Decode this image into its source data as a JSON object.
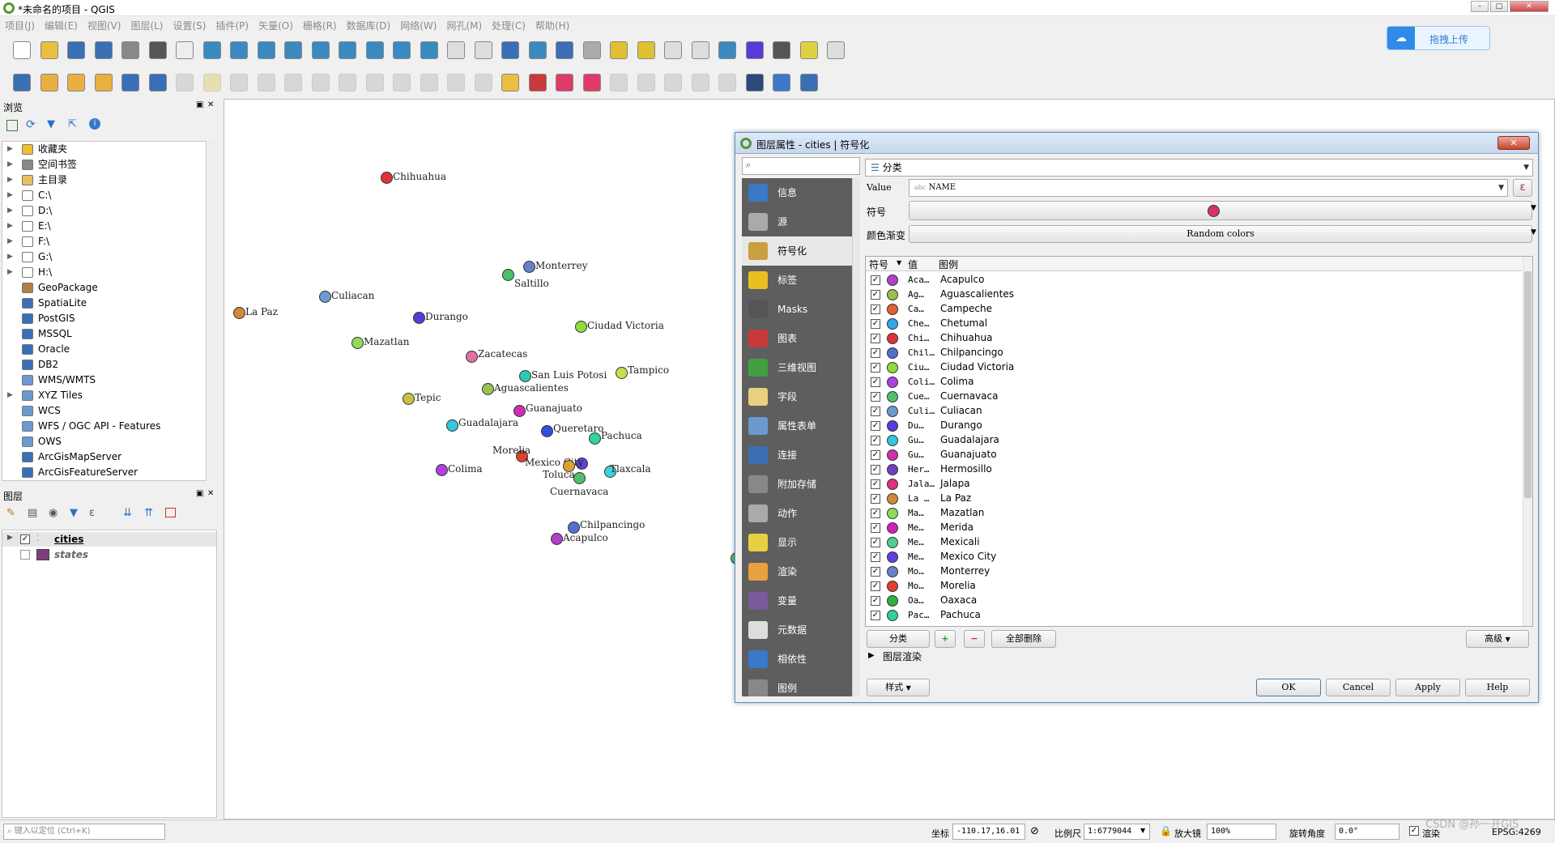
{
  "window": {
    "title": "*未命名的项目 - QGIS"
  },
  "menu": [
    "项目(J)",
    "编辑(E)",
    "视图(V)",
    "图层(L)",
    "设置(S)",
    "插件(P)",
    "矢量(O)",
    "栅格(R)",
    "数据库(D)",
    "网络(W)",
    "网孔(M)",
    "处理(C)",
    "帮助(H)"
  ],
  "cloud_button": {
    "label": "拖拽上传"
  },
  "browser": {
    "title": "浏览",
    "items": [
      {
        "label": "收藏夹",
        "icon": "star-icon"
      },
      {
        "label": "空间书签",
        "icon": "bookmark-icon"
      },
      {
        "label": "主目录",
        "icon": "home-folder-icon"
      },
      {
        "label": "C:\\",
        "icon": "folder-icon"
      },
      {
        "label": "D:\\",
        "icon": "folder-icon"
      },
      {
        "label": "E:\\",
        "icon": "folder-icon"
      },
      {
        "label": "F:\\",
        "icon": "folder-icon"
      },
      {
        "label": "G:\\",
        "icon": "folder-icon"
      },
      {
        "label": "H:\\",
        "icon": "folder-icon"
      },
      {
        "label": "GeoPackage",
        "icon": "geopackage-icon"
      },
      {
        "label": "SpatiaLite",
        "icon": "spatialite-icon"
      },
      {
        "label": "PostGIS",
        "icon": "postgis-icon"
      },
      {
        "label": "MSSQL",
        "icon": "mssql-icon"
      },
      {
        "label": "Oracle",
        "icon": "oracle-icon"
      },
      {
        "label": "DB2",
        "icon": "db2-icon"
      },
      {
        "label": "WMS/WMTS",
        "icon": "globe-icon"
      },
      {
        "label": "XYZ Tiles",
        "icon": "xyz-tiles-icon"
      },
      {
        "label": "WCS",
        "icon": "globe-icon"
      },
      {
        "label": "WFS / OGC API - Features",
        "icon": "globe-icon"
      },
      {
        "label": "OWS",
        "icon": "globe-icon"
      },
      {
        "label": "ArcGisMapServer",
        "icon": "arcgis-icon"
      },
      {
        "label": "ArcGisFeatureServer",
        "icon": "arcgis-icon"
      }
    ]
  },
  "layers_panel": {
    "title": "图层",
    "layers": [
      {
        "name": "cities",
        "checked": true
      },
      {
        "name": "states",
        "checked": false
      }
    ]
  },
  "map": {
    "cities": [
      {
        "name": "Chihuahua",
        "color": "#e0303a"
      },
      {
        "name": "Monterrey",
        "color": "#6a7fc8"
      },
      {
        "name": "Saltillo",
        "color": "#4cbf6a"
      },
      {
        "name": "Culiacan",
        "color": "#6c9bd4"
      },
      {
        "name": "La Paz",
        "color": "#d08a3a"
      },
      {
        "name": "Durango",
        "color": "#5a3ad8"
      },
      {
        "name": "Ciudad Victoria",
        "color": "#90dc40"
      },
      {
        "name": "Mazatlan",
        "color": "#8fdc5a"
      },
      {
        "name": "Zacatecas",
        "color": "#e070a0"
      },
      {
        "name": "San Luis Potosi",
        "color": "#30c8b0"
      },
      {
        "name": "Tampico",
        "color": "#c8e050"
      },
      {
        "name": "Aguascalientes",
        "color": "#9ac050"
      },
      {
        "name": "Tepic",
        "color": "#c8c040"
      },
      {
        "name": "Guanajuato",
        "color": "#d030b0"
      },
      {
        "name": "Guadalajara",
        "color": "#30c8e0"
      },
      {
        "name": "Queretaro",
        "color": "#3050e0"
      },
      {
        "name": "Pachuca",
        "color": "#30d0a0"
      },
      {
        "name": "Morelia",
        "color": "#e04030"
      },
      {
        "name": "Mexico City",
        "color": "#6040d8"
      },
      {
        "name": "Tlaxcala",
        "color": "#40d0e0"
      },
      {
        "name": "Toluca",
        "color": "#e0a030"
      },
      {
        "name": "Cuernavaca",
        "color": "#50c070"
      },
      {
        "name": "Colima",
        "color": "#b040e0"
      },
      {
        "name": "Chilpancingo",
        "color": "#5070d0"
      },
      {
        "name": "Acapulco",
        "color": "#b040c8"
      }
    ]
  },
  "dialog": {
    "title": "图层属性 - cities | 符号化",
    "close_label": "✕",
    "renderer": "分类",
    "value_label": "Value",
    "value_field": "NAME",
    "value_field_prefix": "abc",
    "symbol_label": "符号",
    "ramp_label": "颜色渐变",
    "ramp_value": "Random colors",
    "symbol_color": "#d6336c",
    "nav": [
      {
        "label": "信息",
        "icon": "info-icon"
      },
      {
        "label": "源",
        "icon": "source-icon"
      },
      {
        "label": "符号化",
        "icon": "symbology-icon",
        "selected": true
      },
      {
        "label": "标签",
        "icon": "labels-icon"
      },
      {
        "label": "Masks",
        "icon": "masks-icon"
      },
      {
        "label": "图表",
        "icon": "diagrams-icon"
      },
      {
        "label": "三维视图",
        "icon": "3d-view-icon"
      },
      {
        "label": "字段",
        "icon": "fields-icon"
      },
      {
        "label": "属性表单",
        "icon": "attributes-form-icon"
      },
      {
        "label": "连接",
        "icon": "joins-icon"
      },
      {
        "label": "附加存储",
        "icon": "auxiliary-storage-icon"
      },
      {
        "label": "动作",
        "icon": "actions-icon"
      },
      {
        "label": "显示",
        "icon": "display-icon"
      },
      {
        "label": "渲染",
        "icon": "rendering-icon"
      },
      {
        "label": "变量",
        "icon": "variables-icon"
      },
      {
        "label": "元数据",
        "icon": "metadata-icon"
      },
      {
        "label": "相依性",
        "icon": "dependencies-icon"
      },
      {
        "label": "图例",
        "icon": "legend-icon"
      }
    ],
    "table_headers": {
      "symbol": "符号",
      "value": "值",
      "legend": "图例"
    },
    "categories": [
      {
        "value": "Aca…",
        "legend": "Acapulco",
        "color": "#b040c8"
      },
      {
        "value": "Ag…",
        "legend": "Aguascalientes",
        "color": "#9ac050"
      },
      {
        "value": "Ca…",
        "legend": "Campeche",
        "color": "#e06030"
      },
      {
        "value": "Che…",
        "legend": "Chetumal",
        "color": "#30a8e8"
      },
      {
        "value": "Chi…",
        "legend": "Chihuahua",
        "color": "#e0303a"
      },
      {
        "value": "Chil…",
        "legend": "Chilpancingo",
        "color": "#5070d0"
      },
      {
        "value": "Ciu…",
        "legend": "Ciudad Victoria",
        "color": "#90dc40"
      },
      {
        "value": "Coli…",
        "legend": "Colima",
        "color": "#b040e0"
      },
      {
        "value": "Cue…",
        "legend": "Cuernavaca",
        "color": "#50c070"
      },
      {
        "value": "Culi…",
        "legend": "Culiacan",
        "color": "#6c9bd4"
      },
      {
        "value": "Du…",
        "legend": "Durango",
        "color": "#5a3ad8"
      },
      {
        "value": "Gu…",
        "legend": "Guadalajara",
        "color": "#30c8e0"
      },
      {
        "value": "Gu…",
        "legend": "Guanajuato",
        "color": "#d030b0"
      },
      {
        "value": "Her…",
        "legend": "Hermosillo",
        "color": "#7040c0"
      },
      {
        "value": "Jala…",
        "legend": "Jalapa",
        "color": "#e03080"
      },
      {
        "value": "La …",
        "legend": "La Paz",
        "color": "#d08a3a"
      },
      {
        "value": "Ma…",
        "legend": "Mazatlan",
        "color": "#8fdc5a"
      },
      {
        "value": "Me…",
        "legend": "Merida",
        "color": "#d020c0"
      },
      {
        "value": "Me…",
        "legend": "Mexicali",
        "color": "#50d090"
      },
      {
        "value": "Me…",
        "legend": "Mexico City",
        "color": "#6040d8"
      },
      {
        "value": "Mo…",
        "legend": "Monterrey",
        "color": "#6a7fc8"
      },
      {
        "value": "Mo…",
        "legend": "Morelia",
        "color": "#e04030"
      },
      {
        "value": "Oa…",
        "legend": "Oaxaca",
        "color": "#30b040"
      },
      {
        "value": "Pac…",
        "legend": "Pachuca",
        "color": "#30d0a0"
      }
    ],
    "buttons": {
      "classify": "分类",
      "add": "+",
      "remove": "−",
      "delete_all": "全部删除",
      "advanced": "高级",
      "layer_rendering": "图层渲染",
      "style": "样式",
      "ok": "OK",
      "cancel": "Cancel",
      "apply": "Apply",
      "help": "Help"
    }
  },
  "status": {
    "search_placeholder": "键入以定位 (Ctrl+K)",
    "coord_label": "坐标",
    "coord_value": "-110.17,16.01",
    "scale_label": "比例尺",
    "scale_value": "1:6779044",
    "magnifier_label": "放大镜",
    "magnifier_value": "100%",
    "rotation_label": "旋转角度",
    "rotation_value": "0.0°",
    "render_label": "渲染",
    "epsg": "EPSG:4269",
    "watermark": "CSDN @孙一开GIS"
  }
}
